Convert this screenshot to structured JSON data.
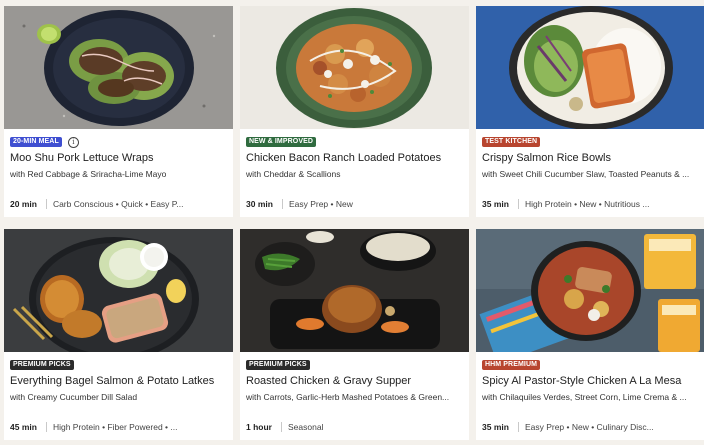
{
  "colors": {
    "blue_badge": "#3f4fd1",
    "green_badge": "#2f6b3f",
    "red_badge": "#b8452f",
    "dark_badge": "#2b2b2b",
    "page_bg": "#f4f1ec"
  },
  "cards": [
    {
      "badge": "20-MIN MEAL",
      "badge_color": "#3f4fd1",
      "title": "Moo Shu Pork Lettuce Wraps",
      "subtitle": "with Red Cabbage & Sriracha-Lime Mayo",
      "time": "20 min",
      "tags": "Carb Conscious • Quick • Easy P..."
    },
    {
      "badge": "NEW & IMPROVED",
      "badge_color": "#2f6b3f",
      "title": "Chicken Bacon Ranch Loaded Potatoes",
      "subtitle": "with Cheddar & Scallions",
      "time": "30 min",
      "tags": "Easy Prep • New"
    },
    {
      "badge": "TEST KITCHEN",
      "badge_color": "#b8452f",
      "title": "Crispy Salmon Rice Bowls",
      "subtitle": "with Sweet Chili Cucumber Slaw, Toasted Peanuts & ...",
      "time": "35 min",
      "tags": "High Protein • New • Nutritious ..."
    },
    {
      "badge": "PREMIUM PICKS",
      "badge_color": "#2b2b2b",
      "title": "Everything Bagel Salmon & Potato Latkes",
      "subtitle": "with Creamy Cucumber Dill Salad",
      "time": "45 min",
      "tags": "High Protein • Fiber Powered • ..."
    },
    {
      "badge": "PREMIUM PICKS",
      "badge_color": "#2b2b2b",
      "title": "Roasted Chicken & Gravy Supper",
      "subtitle": "with Carrots, Garlic-Herb Mashed Potatoes & Green...",
      "time": "1 hour",
      "tags": "Seasonal"
    },
    {
      "badge": "HHM PREMIUM",
      "badge_color": "#b8452f",
      "title": "Spicy Al Pastor-Style Chicken A La Mesa",
      "subtitle": "with Chilaquiles Verdes, Street Corn, Lime Crema & ...",
      "time": "35 min",
      "tags": "Easy Prep • New • Culinary Disc..."
    }
  ]
}
